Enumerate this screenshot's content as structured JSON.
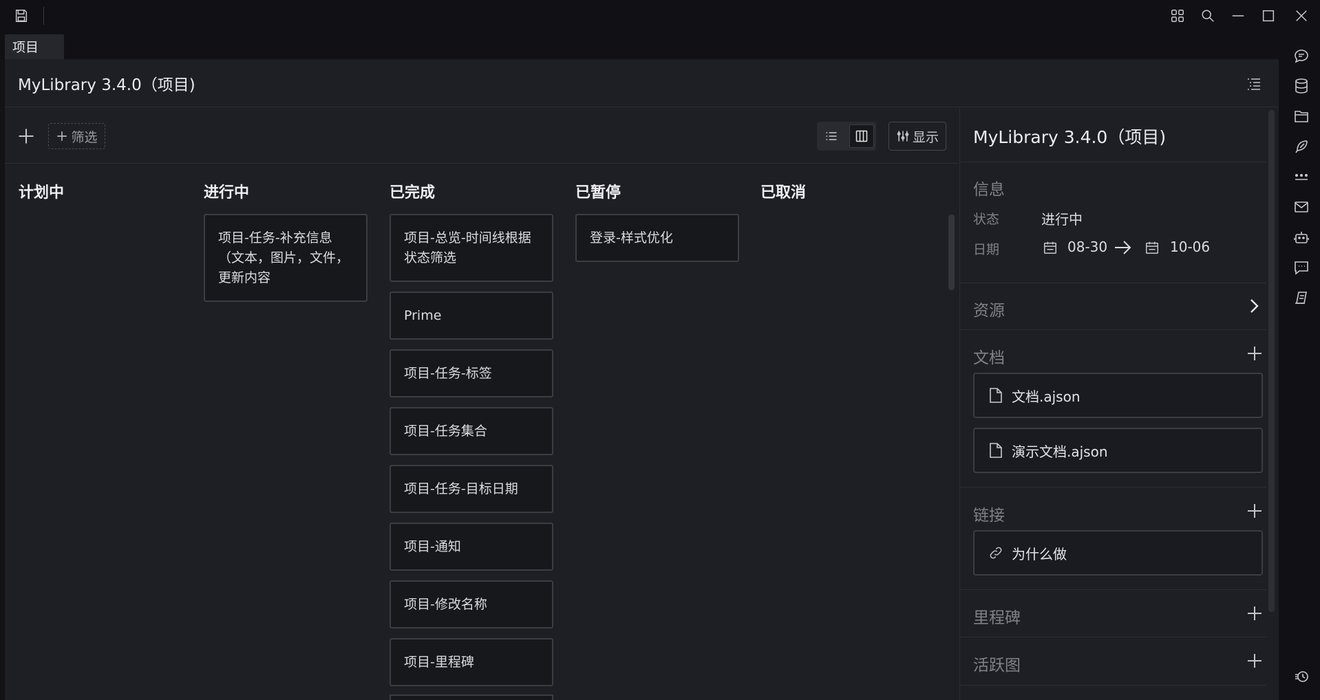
{
  "tab": {
    "label": "项目"
  },
  "header": {
    "title": "MyLibrary 3.4.0（项目)"
  },
  "toolbar": {
    "filter_label": "筛选",
    "display_label": "显示"
  },
  "columns": [
    {
      "title": "计划中",
      "cards": []
    },
    {
      "title": "进行中",
      "cards": [
        "项目-任务-补充信息（文本，图片，文件，更新内容"
      ]
    },
    {
      "title": "已完成",
      "cards": [
        "项目-总览-时间线根据状态筛选",
        "Prime",
        "项目-任务-标签",
        "项目-任务集合",
        "项目-任务-目标日期",
        "项目-通知",
        "项目-修改名称",
        "项目-里程碑"
      ]
    },
    {
      "title": "已暂停",
      "cards": [
        "登录-样式优化"
      ]
    },
    {
      "title": "已取消",
      "cards": []
    }
  ],
  "panel": {
    "title": "MyLibrary 3.4.0（项目)",
    "info_label": "信息",
    "status_label": "状态",
    "status_value": "进行中",
    "date_label": "日期",
    "start_date": "08-30",
    "end_date": "10-06",
    "resources_label": "资源",
    "docs_label": "文档",
    "docs": [
      "文档.ajson",
      "演示文档.ajson"
    ],
    "links_label": "链接",
    "links": [
      "为什么做"
    ],
    "milestones_label": "里程碑",
    "activity_label": "活跃图"
  },
  "sidebar_icons": [
    "comment-icon",
    "database-icon",
    "folder-icon",
    "feather-icon",
    "more-dots-icon",
    "mail-icon",
    "robot-icon",
    "message-icon",
    "notebook-icon",
    "history-icon"
  ],
  "colors": {
    "background": "#1e1f24",
    "card": "#17181c",
    "border": "#3c3d43",
    "text": "#dcdce0",
    "muted": "#808088"
  }
}
